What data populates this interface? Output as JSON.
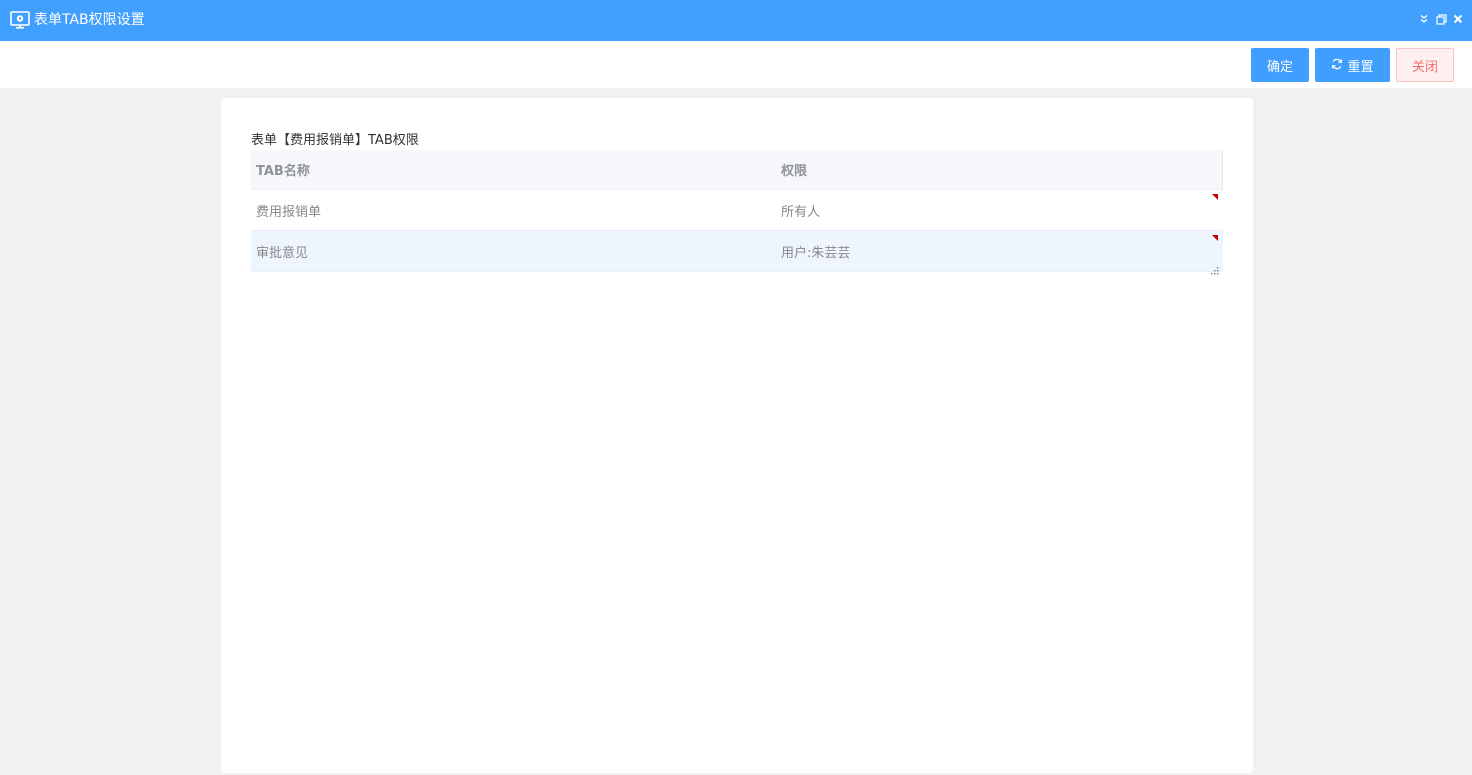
{
  "window": {
    "title": "表单TAB权限设置",
    "icon": "monitor-gear-icon",
    "controls": [
      "collapse-icon",
      "restore-icon",
      "close-icon"
    ]
  },
  "toolbar": {
    "confirm_label": "确定",
    "reset_label": "重置",
    "reset_icon": "refresh-icon",
    "close_label": "关闭"
  },
  "panel": {
    "caption": "表单【费用报销单】TAB权限",
    "columns": {
      "name": "TAB名称",
      "permission": "权限"
    },
    "rows": [
      {
        "name": "费用报销单",
        "permission": "所有人"
      },
      {
        "name": "审批意见",
        "permission": "用户:朱芸芸"
      }
    ]
  },
  "colors": {
    "titlebar": "#419ffe",
    "primary": "#409eff",
    "danger_text": "#f56c6c",
    "danger_bg": "#fef0f0",
    "row_highlight": "#eef5fe",
    "dirty_mark": "#c00000"
  }
}
